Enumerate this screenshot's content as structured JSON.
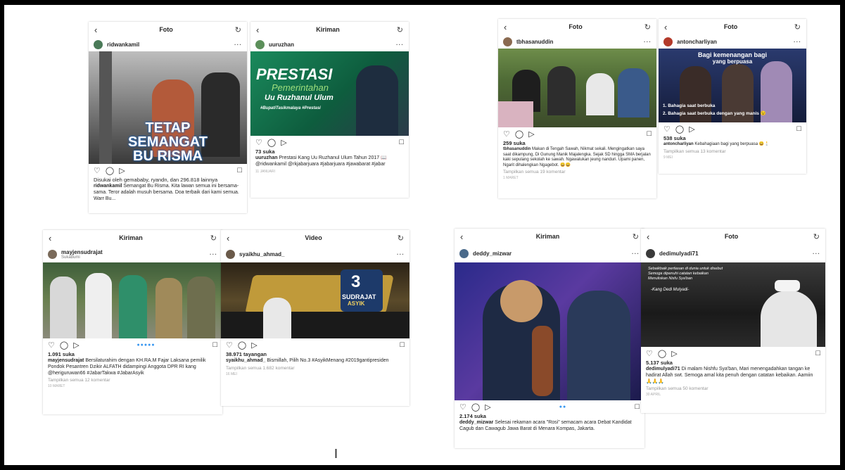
{
  "cards": [
    {
      "title": "Foto",
      "user": "ridwankamil",
      "sub": "",
      "overlay": [
        "TETAP",
        "SEMANGAT",
        "BU RISMA"
      ],
      "likes": "Disukai oleh gemababy, ryandn, dan 296.818 lainnya",
      "caption_user": "ridwankamil",
      "caption": "Semangat Bu Risma. Kita lawan semua ini bersama-sama. Teror adalah musuh bersama. Doa terbaik dari kami semua. Warr Bu...",
      "comments": "",
      "time": ""
    },
    {
      "title": "Kiriman",
      "user": "uuruzhan",
      "sub": "",
      "overlay": [
        "PRESTASI",
        "Pemerintahan",
        "Uu Ruzhanul Ulum",
        "#BupatiTasikmalaya #Prestasi"
      ],
      "likes": "73 suka",
      "caption_user": "uuruzhan",
      "caption": "Prestasi Kang Uu Ruzhanul Ulum Tahun 2017 📖 @ridwankamil @rkjabarjuara #jabarjuara #jawabarat #jabar",
      "comments": "",
      "time": "11 JANUARI"
    },
    {
      "title": "Foto",
      "user": "tbhasanuddin",
      "sub": "",
      "overlay": [],
      "likes": "259 suka",
      "caption_user": "tbhasanuddin",
      "caption": "Makan di Tengah Sawah, Nikmat sekali. Mengingatkan saya saat dikampung, Di Gunung Manik Majalengka. Sejak SD hingga SMA berjalan kaki sepulang sekolah ke sawah. Ngawalukan jeung nanduri. Upami panen, Ngarit dihalengkan Ngagebot. 😀😀",
      "comments": "Tampilkan semua 19 komentar",
      "time": "1 MARET"
    },
    {
      "title": "Foto",
      "user": "antoncharliyan",
      "sub": "",
      "overlay": [
        "Bagi kemenangan bagi",
        "yang berpuasa",
        "1. Bahagia saat berbuka",
        "2. Bahagia saat berbuka dengan yang manis 😉"
      ],
      "likes": "538 suka",
      "caption_user": "antoncharliyan",
      "caption": "Kebahagiaan bagi yang berpuasa 😀🕯️",
      "comments": "Tampilkan semua 13 komentar",
      "time": "9 MEI"
    },
    {
      "title": "Kiriman",
      "user": "mayjensudrajat",
      "sub": "Sukabumi",
      "overlay": [],
      "likes": "1.091 suka",
      "caption_user": "mayjensudrajat",
      "caption": "Bersilaturahim dengan KH.RA.M Fajar Laksana pemilik Pondok Pesantren Dzikir ALFATH didampingi Anggota DPR RI kang @heriguruwan66 #JabarTakwa #JabarAsyik",
      "comments": "Tampilkan semua 12 komentar",
      "time": "10 MARET"
    },
    {
      "title": "Video",
      "user": "syaikhu_ahmad_",
      "sub": "",
      "overlay": [
        "3",
        "SUDRAJAT",
        "ASYIK"
      ],
      "likes": "38.971 tayangan",
      "caption_user": "syaikhu_ahmad_",
      "caption": "Bismillah, Pilih No.3 #AsyikMenang #2019gantipresiden",
      "comments": "Tampilkan semua 1.682 komentar",
      "time": "16 MEI"
    },
    {
      "title": "Kiriman",
      "user": "deddy_mizwar",
      "sub": "",
      "overlay": [],
      "likes": "2.174 suka",
      "caption_user": "deddy_mizwar",
      "caption": "Selesai rekaman acara \"Rosi\" semacam acara Debat Kandidat Cagub dan Cawagub Jawa Barat di Menara Kompas, Jakarta.",
      "comments": "",
      "time": ""
    },
    {
      "title": "Foto",
      "user": "dedimulyadi71",
      "sub": "",
      "overlay": [
        "Sebaikbaik pertiasan di dunia untuk disebut",
        "Semoga dipenuhi catatan kebaikan",
        "Menuliskan Nisfu Sya'ban",
        "-Kang Dedi Mulyadi-"
      ],
      "likes": "5.137 suka",
      "caption_user": "dedimulyadi71",
      "caption": "Di malam Nishfu Sya'ban, Mari menengadahkan tangan ke hadirat Allah swt. Semoga amal kita penuh dengan catatan kebaikan. Aamiin 🙏🙏🙏",
      "comments": "Tampilkan semua 50 komentar",
      "time": "30 APRIL"
    }
  ],
  "cursor_char": "I",
  "icons": {
    "back": "chevron-left-icon",
    "refresh": "refresh-icon",
    "heart": "heart-icon",
    "comment": "comment-icon",
    "share": "share-icon",
    "bookmark": "bookmark-icon",
    "more": "more-icon"
  }
}
